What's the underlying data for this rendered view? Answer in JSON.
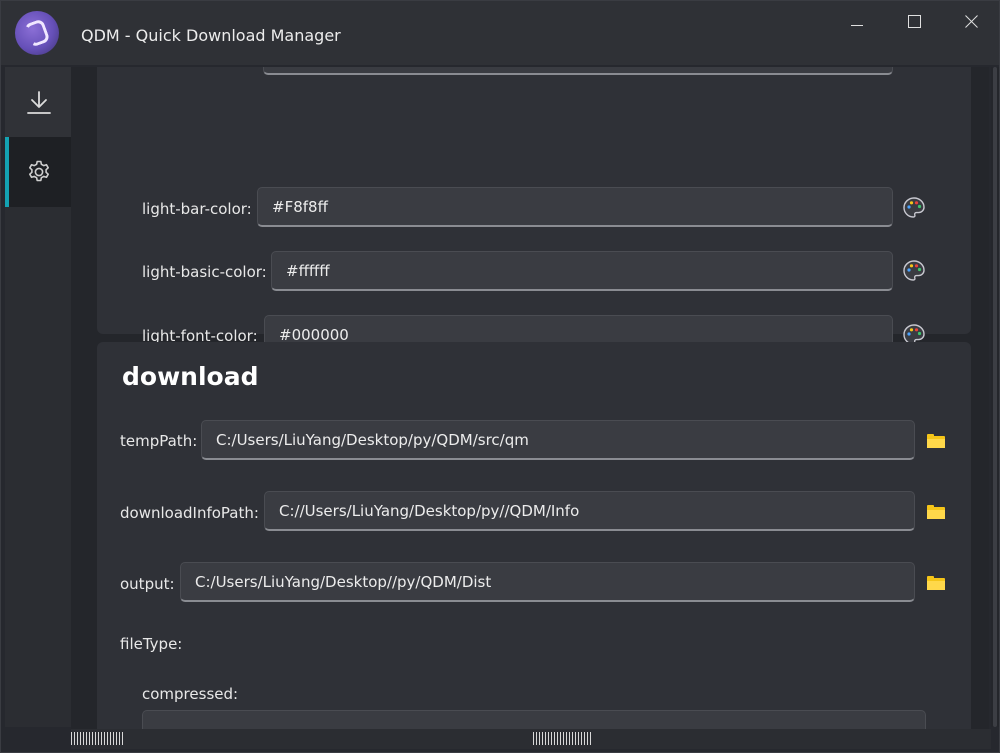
{
  "window": {
    "title": "QDM - Quick Download Manager"
  },
  "sidebar": {
    "items": [
      {
        "icon": "download-icon",
        "active": false
      },
      {
        "icon": "gear-icon",
        "active": true
      }
    ],
    "accent_color": "#14a3b3"
  },
  "light_section": {
    "fields": [
      {
        "label": "light-bar-color:",
        "value": "#F8f8ff",
        "icon": "palette-icon"
      },
      {
        "label": "light-basic-color:",
        "value": "#ffffff",
        "icon": "palette-icon"
      },
      {
        "label": "light-font-color:",
        "value": "#000000",
        "icon": "palette-icon"
      }
    ]
  },
  "download_section": {
    "title": "download",
    "fields": [
      {
        "label": "tempPath:",
        "value": "C:/Users/LiuYang/Desktop/py/QDM/src/qm",
        "icon": "folder-icon"
      },
      {
        "label": "downloadInfoPath:",
        "value": "C://Users/LiuYang/Desktop/py//QDM/Info",
        "icon": "folder-icon"
      },
      {
        "label": "output:",
        "value": "C:/Users/LiuYang/Desktop//py/QDM/Dist",
        "icon": "folder-icon"
      }
    ],
    "file_type_label": "fileType:",
    "compressed_label": "compressed:"
  }
}
